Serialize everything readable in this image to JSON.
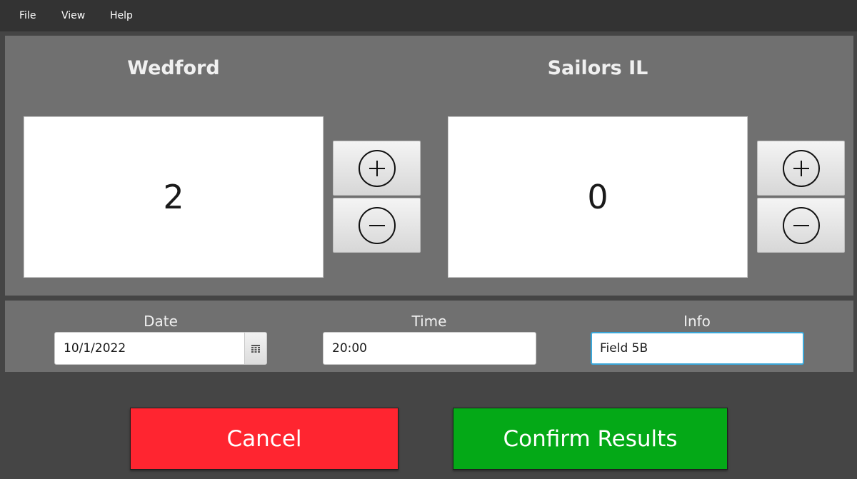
{
  "menu": {
    "items": [
      "File",
      "View",
      "Help"
    ]
  },
  "teams": {
    "left": {
      "name": "Wedford",
      "score": "2"
    },
    "right": {
      "name": "Sailors IL",
      "score": "0"
    }
  },
  "details": {
    "date": {
      "label": "Date",
      "value": "10/1/2022"
    },
    "time": {
      "label": "Time",
      "value": "20:00"
    },
    "info": {
      "label": "Info",
      "value": "Field 5B"
    }
  },
  "actions": {
    "cancel_label": "Cancel",
    "confirm_label": "Confirm Results"
  },
  "colors": {
    "cancel": "#ff2530",
    "confirm": "#04a917",
    "focus": "#3ba7d9"
  },
  "icons": [
    "plus-circle-icon",
    "minus-circle-icon",
    "calendar-icon"
  ]
}
